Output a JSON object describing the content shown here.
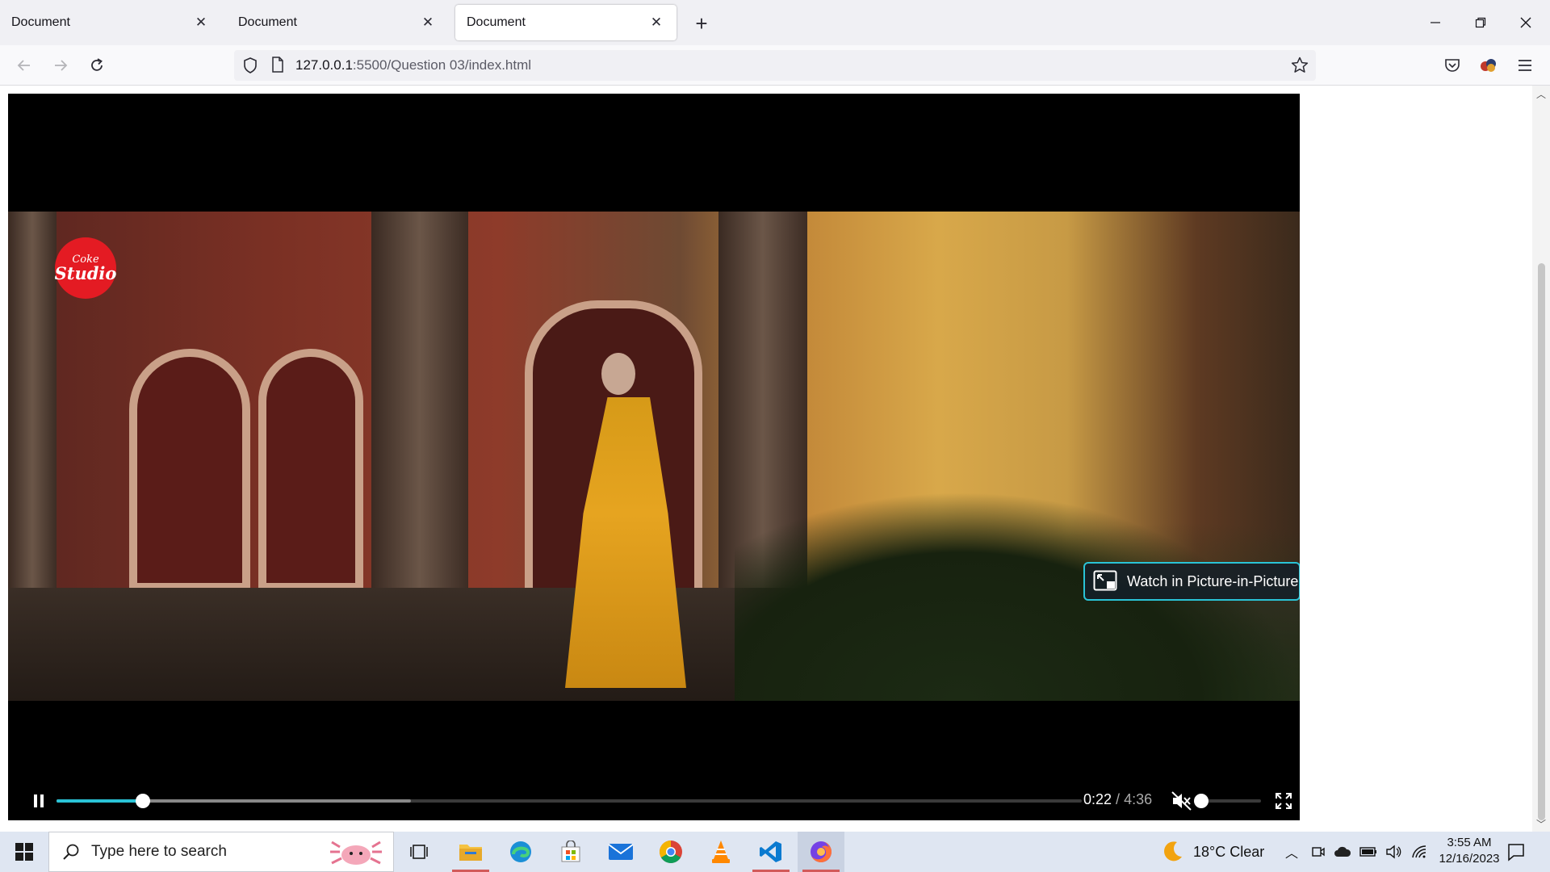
{
  "browser": {
    "tabs": [
      {
        "title": "Document",
        "active": false
      },
      {
        "title": "Document",
        "active": false
      },
      {
        "title": "Document",
        "active": true
      }
    ],
    "url_host": "127.0.0.1",
    "url_rest": ":5500/Question 03/index.html"
  },
  "video": {
    "logo_line1": "Coke",
    "logo_line2": "Studio",
    "pip_label": "Watch in Picture-in-Picture",
    "current_time": "0:22",
    "separator": " / ",
    "duration": "4:36",
    "played_fraction": 0.084,
    "buffered_fraction": 0.346,
    "volume_fraction": 0.0,
    "muted": true,
    "accent_color": "#2ac3d6"
  },
  "taskbar": {
    "search_placeholder": "Type here to search",
    "weather": "18°C  Clear",
    "time": "3:55 AM",
    "date": "12/16/2023",
    "apps": [
      "task-view",
      "file-explorer",
      "edge",
      "microsoft-store",
      "mail",
      "chrome",
      "vlc",
      "vscode",
      "firefox"
    ]
  }
}
